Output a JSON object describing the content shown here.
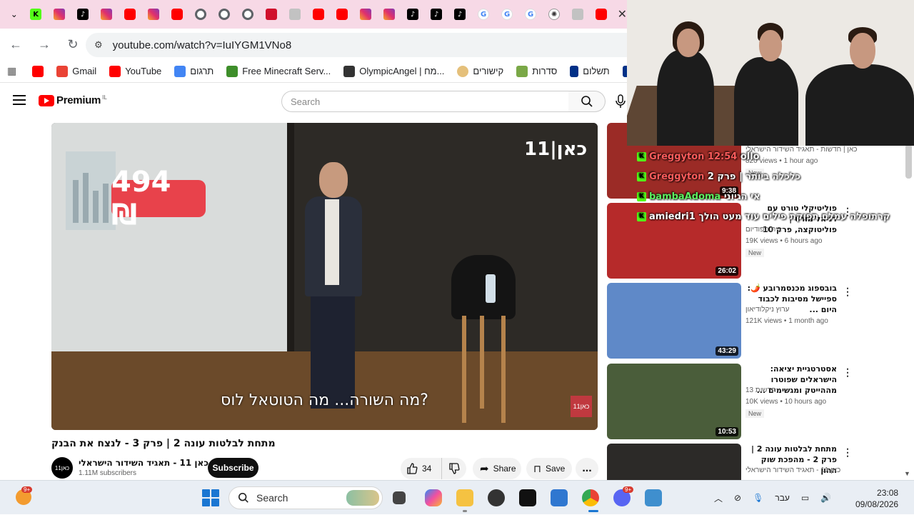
{
  "browser": {
    "tabs": [
      "kick",
      "instagram",
      "tiktok",
      "instagram",
      "youtube",
      "instagram",
      "youtube",
      "chrome",
      "chrome",
      "chrome",
      "red-app",
      "gray-app",
      "youtube",
      "youtube",
      "instagram",
      "instagram",
      "tiktok",
      "tiktok",
      "tiktok",
      "google",
      "google",
      "google",
      "openai",
      "rainbow",
      "youtube"
    ],
    "url": "youtube.com/watch?v=IuIYGM1VNo8",
    "bookmarks": [
      {
        "label": "",
        "icon": "youtube-icon"
      },
      {
        "label": "Gmail",
        "icon": "gmail-icon"
      },
      {
        "label": "YouTube",
        "icon": "youtube-icon"
      },
      {
        "label": "תרגום",
        "icon": "translate-icon"
      },
      {
        "label": "Free Minecraft Serv...",
        "icon": "minecraft-icon"
      },
      {
        "label": "OlympicAngel | מח...",
        "icon": "olympic-icon"
      },
      {
        "label": "קישורים",
        "icon": "star-icon"
      },
      {
        "label": "סדרות",
        "icon": "tv-icon"
      },
      {
        "label": "תשלום",
        "icon": "paypal-icon"
      },
      {
        "label": "F",
        "icon": "paypal-icon"
      }
    ]
  },
  "youtube": {
    "logo": "Premium",
    "country": "IL",
    "search_placeholder": "Search"
  },
  "video": {
    "price_tag": "494 ₪",
    "watermark": "כאן|11",
    "subtitle": "מה השורה... מה הטוטאל לוס?",
    "corner_logo": "כאן11",
    "title": "מתחת לבלטות עונה 2 | פרק 3 - לנצח את הבנק",
    "channel_avatar_text": "כאן11",
    "channel_name": "כאן 11 - תאגיד השידור הישראלי",
    "subscribers": "1.11M subscribers",
    "subscribe_label": "Subscribe",
    "likes": "34",
    "share_label": "Share",
    "save_label": "Save",
    "more_label": "..."
  },
  "recommendations": [
    {
      "title": "",
      "channel": "כאן | חדשות - תאגיד השידור הישראלי",
      "views": "820 views • 1 hour ago",
      "badge": "New",
      "duration": "9:38",
      "thumb_color": "#9b2b26"
    },
    {
      "title": "פוליטיקלי טורט עם דניאל מורס | פוליטוקצה, פרק 10",
      "channel": "בית הפודיום",
      "views": "19K views • 6 hours ago",
      "badge": "New",
      "duration": "26:02",
      "thumb_color": "#b62a2a"
    },
    {
      "title": "בובספוג מכנסמרובע 🌶️: ספיישל מסיבות לכבוד היום ...",
      "channel": "ערוץ ניקלודיאון",
      "views": "121K views • 1 month ago",
      "badge": "",
      "duration": "43:29",
      "thumb_color": "#5f89c8"
    },
    {
      "title": "אסטרטגיית יציאה: הישראלים שפוטרו מההייטק ומגשימים ...",
      "channel": "חדשות 13",
      "views": "10K views • 10 hours ago",
      "badge": "New",
      "duration": "10:53",
      "thumb_color": "#4a5d3a"
    },
    {
      "title": "מתחת לבלטות עונה 2 | פרק 2 - מהפכת שוק ההון",
      "channel": "כאן 11 - תאגיד השידור הישראלי",
      "views": "",
      "badge": "",
      "duration": "",
      "thumb_color": "#2c2a28"
    }
  ],
  "chat": [
    {
      "user": "Greggyton 12:54",
      "msg": "ollo"
    },
    {
      "user": "Greggyton",
      "msg": "כלכלה ביותר | פרק 2"
    },
    {
      "user": "bambaAdoma",
      "msg": "אי הגיוני"
    },
    {
      "user": "amiedri1",
      "msg": "קרתופלה עמלם תפוקת פילים עוד מעט הולך"
    }
  ],
  "taskbar": {
    "weather_badge": "9+",
    "search_label": "Search",
    "discord_badge": "9+",
    "language": "עבר",
    "time": "23:08",
    "date": "09/08/2026"
  }
}
